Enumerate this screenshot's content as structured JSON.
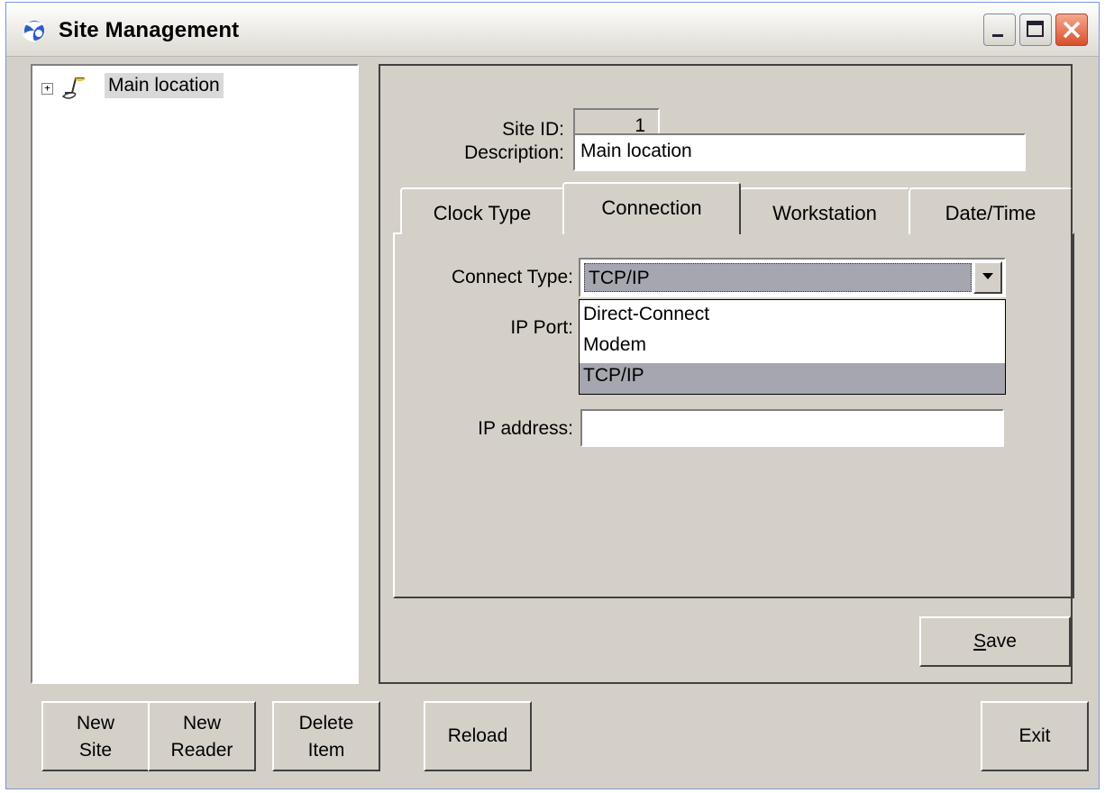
{
  "window": {
    "title": "Site Management"
  },
  "tree": {
    "root_label": "Main location",
    "expander": "+"
  },
  "form": {
    "site_id_label": "Site ID:",
    "site_id_value": "1",
    "description_label": "Description:",
    "description_value": "Main location"
  },
  "tabs": {
    "clock_type": "Clock Type",
    "connection": "Connection",
    "workstation": "Workstation",
    "date_time": "Date/Time",
    "active": "Connection"
  },
  "connection": {
    "connect_type_label": "Connect Type:",
    "connect_type_value": "TCP/IP",
    "options": [
      "Direct-Connect",
      "Modem",
      "TCP/IP"
    ],
    "ip_port_label": "IP Port:",
    "ip_address_label": "IP address:",
    "ip_address_value": ""
  },
  "buttons": {
    "save_rest": "ave",
    "save_mnemonic": "S",
    "new_site_1": "New",
    "new_site_2": "Site",
    "new_reader_1": "New",
    "new_reader_2": "Reader",
    "delete_item_1": "Delete",
    "delete_item_2": "Item",
    "reload": "Reload",
    "exit": "Exit"
  },
  "colors": {
    "window_bg": "#d4d0c8",
    "selection": "#a6a6b0",
    "close_button": "#d94f2b"
  }
}
